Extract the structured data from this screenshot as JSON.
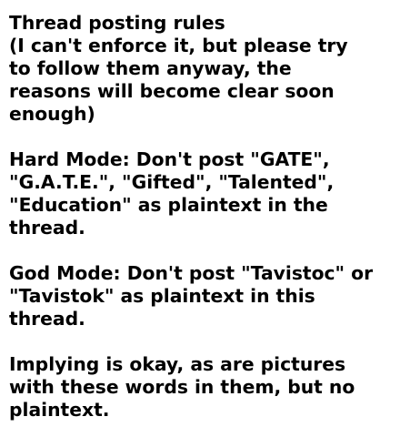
{
  "document": {
    "title": "Thread posting rules",
    "intro": "(I can't enforce it, but please try\nto follow them anyway, the\nreasons will become clear soon\nenough)",
    "hard_mode": "Hard Mode: Don't post \"GATE\",\n\"G.A.T.E.\", \"Gifted\", \"Talented\",\n\"Education\" as plaintext in the\nthread.",
    "god_mode": "God Mode: Don't post \"Tavistoc\" or\n\"Tavistok\" as plaintext in this\nthread.",
    "implying": "Implying is okay, as are pictures\nwith these words in them, but no\nplaintext."
  }
}
